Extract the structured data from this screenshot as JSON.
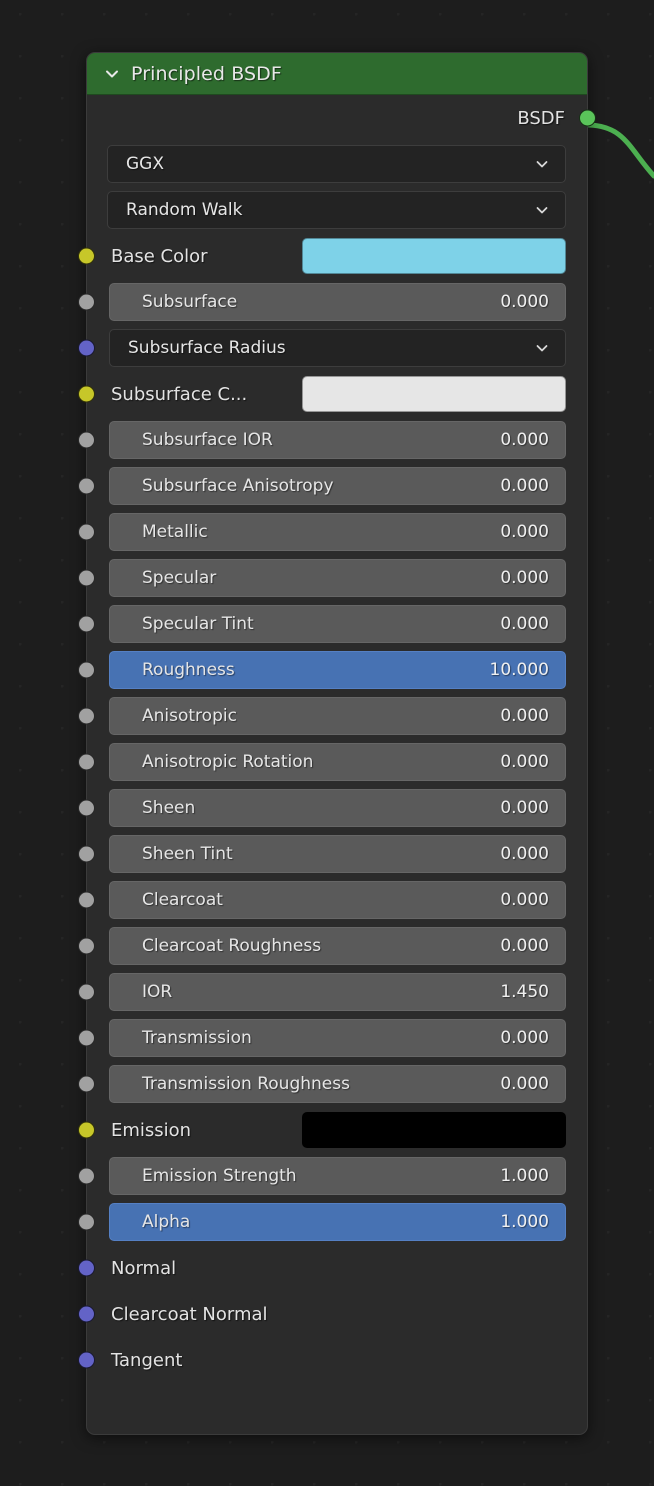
{
  "editor": {
    "name": "shader-node-editor",
    "background_color": "#1d1d1d",
    "grid_dot_color": "#2a2a2a"
  },
  "node": {
    "title": "Principled BSDF",
    "header_color": "#2e6b2e",
    "body_color": "#2b2b2b",
    "collapse_icon": "chevron-down-icon",
    "outputs": [
      {
        "label": "BSDF",
        "socket_color": "#5ac45a",
        "socket_type": "shader",
        "connected": true
      }
    ],
    "selectors": [
      {
        "label": "GGX",
        "icon": "chevron-down-icon"
      },
      {
        "label": "Random Walk",
        "icon": "chevron-down-icon"
      }
    ],
    "inputs": [
      {
        "kind": "color",
        "label": "Base Color",
        "socket_color": "#c7c729",
        "value_color": "#7ed2e8"
      },
      {
        "kind": "slider",
        "label": "Subsurface",
        "socket_color": "#a1a1a1",
        "value": "0.000",
        "selected": false
      },
      {
        "kind": "dropdown",
        "label": "Subsurface Radius",
        "socket_color": "#6363c7",
        "icon": "chevron-down-icon"
      },
      {
        "kind": "color",
        "label": "Subsurface C...",
        "socket_color": "#c7c729",
        "value_color": "#e6e6e6"
      },
      {
        "kind": "slider",
        "label": "Subsurface IOR",
        "socket_color": "#a1a1a1",
        "value": "0.000",
        "selected": false
      },
      {
        "kind": "slider",
        "label": "Subsurface Anisotropy",
        "socket_color": "#a1a1a1",
        "value": "0.000",
        "selected": false
      },
      {
        "kind": "slider",
        "label": "Metallic",
        "socket_color": "#a1a1a1",
        "value": "0.000",
        "selected": false
      },
      {
        "kind": "slider",
        "label": "Specular",
        "socket_color": "#a1a1a1",
        "value": "0.000",
        "selected": false
      },
      {
        "kind": "slider",
        "label": "Specular Tint",
        "socket_color": "#a1a1a1",
        "value": "0.000",
        "selected": false
      },
      {
        "kind": "slider",
        "label": "Roughness",
        "socket_color": "#a1a1a1",
        "value": "10.000",
        "selected": true
      },
      {
        "kind": "slider",
        "label": "Anisotropic",
        "socket_color": "#a1a1a1",
        "value": "0.000",
        "selected": false
      },
      {
        "kind": "slider",
        "label": "Anisotropic Rotation",
        "socket_color": "#a1a1a1",
        "value": "0.000",
        "selected": false
      },
      {
        "kind": "slider",
        "label": "Sheen",
        "socket_color": "#a1a1a1",
        "value": "0.000",
        "selected": false
      },
      {
        "kind": "slider",
        "label": "Sheen Tint",
        "socket_color": "#a1a1a1",
        "value": "0.000",
        "selected": false
      },
      {
        "kind": "slider",
        "label": "Clearcoat",
        "socket_color": "#a1a1a1",
        "value": "0.000",
        "selected": false
      },
      {
        "kind": "slider",
        "label": "Clearcoat Roughness",
        "socket_color": "#a1a1a1",
        "value": "0.000",
        "selected": false
      },
      {
        "kind": "slider",
        "label": "IOR",
        "socket_color": "#a1a1a1",
        "value": "1.450",
        "selected": false
      },
      {
        "kind": "slider",
        "label": "Transmission",
        "socket_color": "#a1a1a1",
        "value": "0.000",
        "selected": false
      },
      {
        "kind": "slider",
        "label": "Transmission Roughness",
        "socket_color": "#a1a1a1",
        "value": "0.000",
        "selected": false
      },
      {
        "kind": "color",
        "label": "Emission",
        "socket_color": "#c7c729",
        "value_color": "#000000"
      },
      {
        "kind": "slider",
        "label": "Emission Strength",
        "socket_color": "#a1a1a1",
        "value": "1.000",
        "selected": false
      },
      {
        "kind": "slider",
        "label": "Alpha",
        "socket_color": "#a1a1a1",
        "value": "1.000",
        "selected": true
      },
      {
        "kind": "plain",
        "label": "Normal",
        "socket_color": "#6363c7"
      },
      {
        "kind": "plain",
        "label": "Clearcoat Normal",
        "socket_color": "#6363c7"
      },
      {
        "kind": "plain",
        "label": "Tangent",
        "socket_color": "#6363c7"
      }
    ]
  },
  "link": {
    "name": "bsdf-output-link",
    "color": "#4caf50"
  }
}
